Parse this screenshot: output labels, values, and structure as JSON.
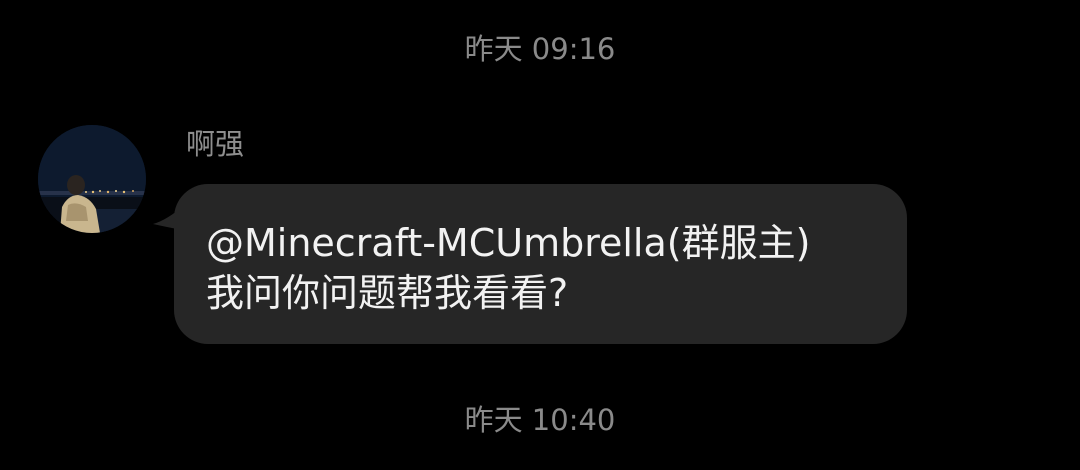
{
  "chat": {
    "timestamps": {
      "first": "昨天 09:16",
      "second": "昨天 10:40"
    },
    "message": {
      "sender": "啊强",
      "avatar_icon": "user-avatar-night-city",
      "text": "@Minecraft-MCUmbrella(群服主) 我问你问题帮我看看?"
    }
  },
  "colors": {
    "background": "#000000",
    "bubble": "#262626",
    "timestamp_text": "#8a8a8a",
    "message_text": "#f2f2f2"
  }
}
